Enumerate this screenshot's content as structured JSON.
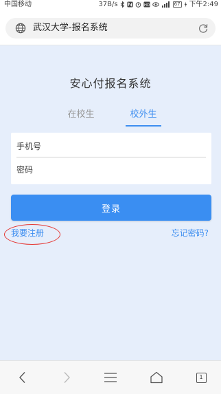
{
  "status_bar": {
    "carrier": "中国移动",
    "network_speed": "37B/s",
    "battery": "67",
    "time": "下午2:49"
  },
  "address_bar": {
    "url_title": "武汉大学-报名系统",
    "icons": [
      "globe-icon",
      "refresh-icon"
    ]
  },
  "page": {
    "title": "安心付报名系统",
    "tabs": [
      {
        "label": "在校生",
        "active": false
      },
      {
        "label": "校外生",
        "active": true
      }
    ],
    "phone_placeholder": "手机号",
    "password_placeholder": "密码",
    "login_label": "登录",
    "register_label": "我要注册",
    "forgot_label": "忘记密码?",
    "accent_color": "#3a8ef2",
    "annotation_color": "#e53935"
  },
  "bottom_nav": {
    "tab_count": "1",
    "icons": [
      "back-icon",
      "forward-icon",
      "menu-icon",
      "home-icon",
      "tabs-icon"
    ]
  }
}
